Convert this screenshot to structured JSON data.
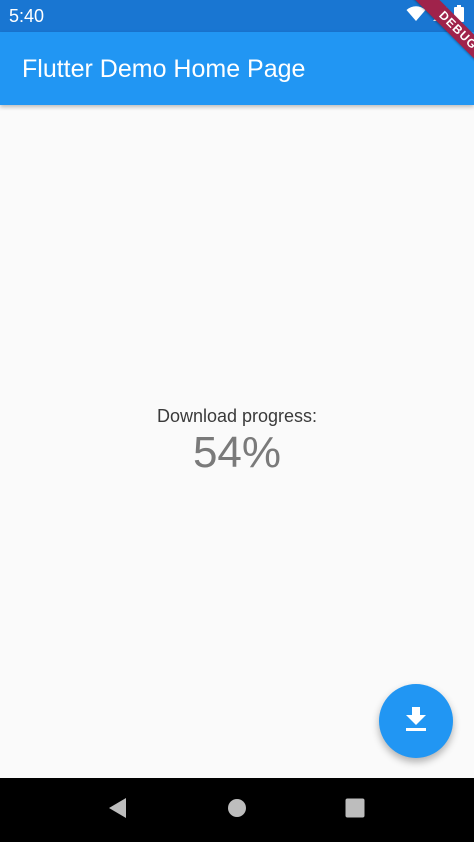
{
  "status_bar": {
    "time": "5:40",
    "icons": [
      "wifi-icon",
      "signal-icon",
      "battery-icon"
    ],
    "color": "#1976d2"
  },
  "app_bar": {
    "title": "Flutter Demo Home Page",
    "color": "#2196f3"
  },
  "debug_banner": {
    "label": "DEBUG",
    "color": "#a0234b"
  },
  "body": {
    "progress_label": "Download progress:",
    "progress_value": "54%"
  },
  "fab": {
    "icon": "download-icon",
    "color": "#2196f3"
  },
  "nav_bar": {
    "buttons": [
      "back-icon",
      "home-icon",
      "recents-icon"
    ]
  }
}
